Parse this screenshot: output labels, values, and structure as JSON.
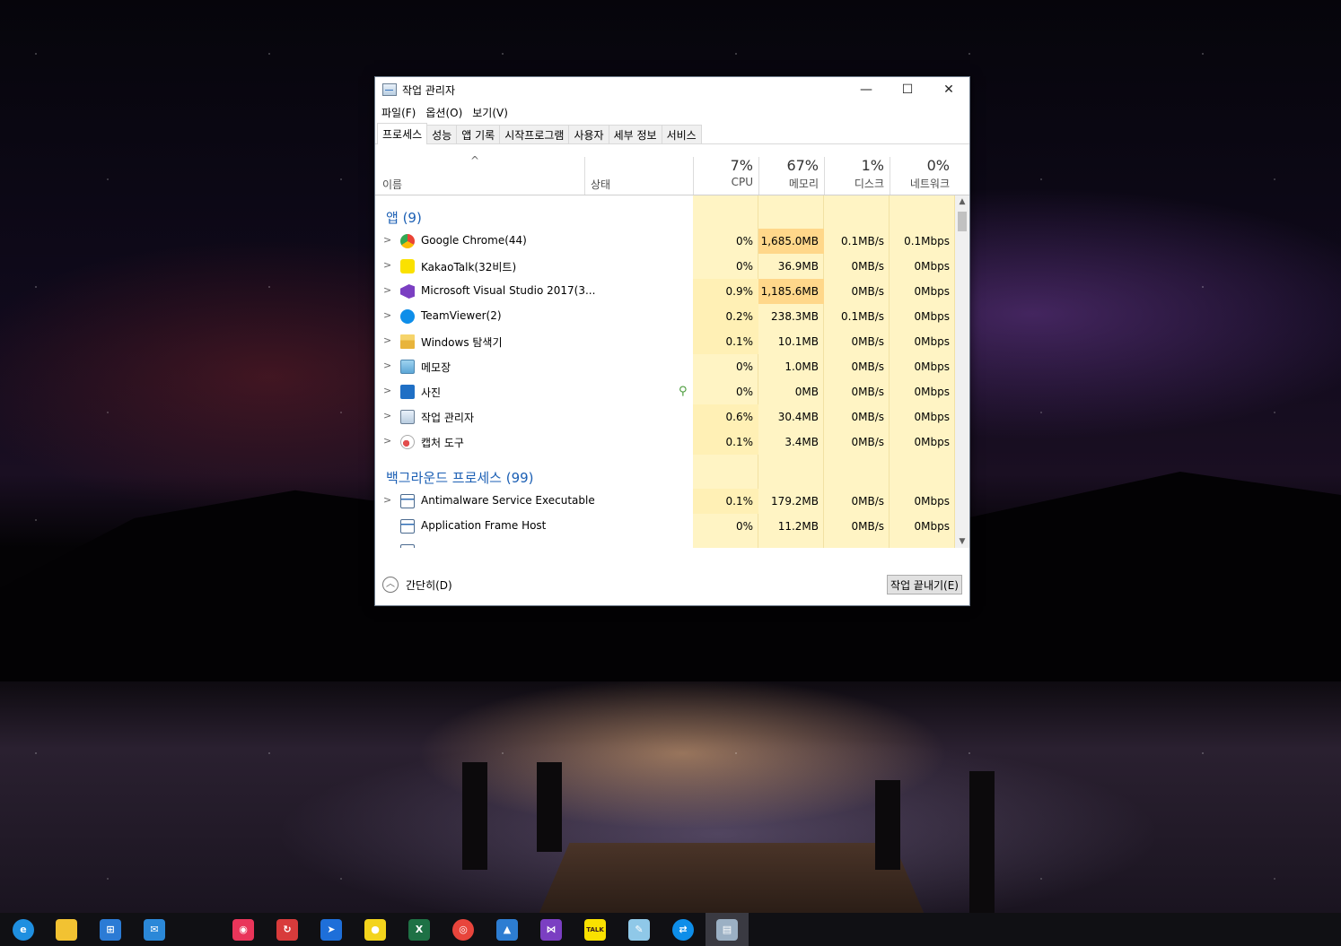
{
  "window": {
    "title": "작업 관리자",
    "controls": {
      "minimize": "—",
      "maximize": "☐",
      "close": "✕"
    }
  },
  "menu": [
    "파일(F)",
    "옵션(O)",
    "보기(V)"
  ],
  "tabs": [
    "프로세스",
    "성능",
    "앱 기록",
    "시작프로그램",
    "사용자",
    "세부 정보",
    "서비스"
  ],
  "active_tab": "프로세스",
  "header": {
    "sort_arrow": "^",
    "name": "이름",
    "status": "상태",
    "cpu": {
      "pct": "7%",
      "label": "CPU"
    },
    "memory": {
      "pct": "67%",
      "label": "메모리"
    },
    "disk": {
      "pct": "1%",
      "label": "디스크"
    },
    "network": {
      "pct": "0%",
      "label": "네트워크"
    }
  },
  "groups": {
    "apps": "앱 (9)",
    "background": "백그라운드 프로세스 (99)"
  },
  "apps": [
    {
      "name": "Google Chrome(44)",
      "icon": "chrome-icon",
      "cpu": "0%",
      "mem": "1,685.0MB",
      "disk": "0.1MB/s",
      "net": "0.1Mbps",
      "mem_hot": true
    },
    {
      "name": "KakaoTalk(32비트)",
      "icon": "kakaotalk-icon",
      "cpu": "0%",
      "mem": "36.9MB",
      "disk": "0MB/s",
      "net": "0Mbps"
    },
    {
      "name": "Microsoft Visual Studio 2017(3...",
      "icon": "visual-studio-icon",
      "cpu": "0.9%",
      "mem": "1,185.6MB",
      "disk": "0MB/s",
      "net": "0Mbps",
      "mem_hot": true
    },
    {
      "name": "TeamViewer(2)",
      "icon": "teamviewer-icon",
      "cpu": "0.2%",
      "mem": "238.3MB",
      "disk": "0.1MB/s",
      "net": "0Mbps"
    },
    {
      "name": "Windows 탐색기",
      "icon": "file-explorer-icon",
      "cpu": "0.1%",
      "mem": "10.1MB",
      "disk": "0MB/s",
      "net": "0Mbps"
    },
    {
      "name": "메모장",
      "icon": "notepad-icon",
      "cpu": "0%",
      "mem": "1.0MB",
      "disk": "0MB/s",
      "net": "0Mbps"
    },
    {
      "name": "사진",
      "icon": "photos-icon",
      "cpu": "0%",
      "mem": "0MB",
      "disk": "0MB/s",
      "net": "0Mbps",
      "suspended": true
    },
    {
      "name": "작업 관리자",
      "icon": "task-manager-icon",
      "cpu": "0.6%",
      "mem": "30.4MB",
      "disk": "0MB/s",
      "net": "0Mbps"
    },
    {
      "name": "캡처 도구",
      "icon": "snipping-tool-icon",
      "cpu": "0.1%",
      "mem": "3.4MB",
      "disk": "0MB/s",
      "net": "0Mbps"
    }
  ],
  "background": [
    {
      "name": "Antimalware Service Executable",
      "icon": "service-icon",
      "cpu": "0.1%",
      "mem": "179.2MB",
      "disk": "0MB/s",
      "net": "0Mbps",
      "expandable": true
    },
    {
      "name": "Application Frame Host",
      "icon": "service-icon",
      "cpu": "0%",
      "mem": "11.2MB",
      "disk": "0MB/s",
      "net": "0Mbps",
      "expandable": false
    }
  ],
  "footer": {
    "collapse": "간단히(D)",
    "end_task": "작업 끝내기(E)"
  },
  "taskbar": [
    {
      "name": "edge-icon",
      "color": "#1f8fe0",
      "glyph": "e"
    },
    {
      "name": "file-explorer-icon",
      "color": "#f2c232",
      "glyph": ""
    },
    {
      "name": "microsoft-store-icon",
      "color": "#2b7bd5",
      "glyph": "⊞"
    },
    {
      "name": "mail-icon",
      "color": "#2b88d8",
      "glyph": "✉"
    },
    {
      "name": "app-icon-pink",
      "color": "#e9355a",
      "glyph": "◉"
    },
    {
      "name": "sync-app-icon",
      "color": "#d83b3b",
      "glyph": "↻"
    },
    {
      "name": "blue-app-icon",
      "color": "#1e6fd9",
      "glyph": "➤"
    },
    {
      "name": "lemon-app-icon",
      "color": "#f3d41c",
      "glyph": "●"
    },
    {
      "name": "excel-icon",
      "color": "#1e7145",
      "glyph": "X"
    },
    {
      "name": "chrome-icon",
      "color": "#e8453c",
      "glyph": "◎"
    },
    {
      "name": "photos-icon",
      "color": "#2d7dd2",
      "glyph": "▲"
    },
    {
      "name": "visual-studio-icon",
      "color": "#7b3fc2",
      "glyph": "⋈"
    },
    {
      "name": "kakaotalk-icon",
      "color": "#fae100",
      "glyph": "TALK"
    },
    {
      "name": "notepad-icon",
      "color": "#8fc8e8",
      "glyph": "✎"
    },
    {
      "name": "teamviewer-icon",
      "color": "#0e8ee9",
      "glyph": "⇄"
    },
    {
      "name": "task-manager-icon",
      "color": "#9bb0c4",
      "glyph": "▤"
    }
  ]
}
